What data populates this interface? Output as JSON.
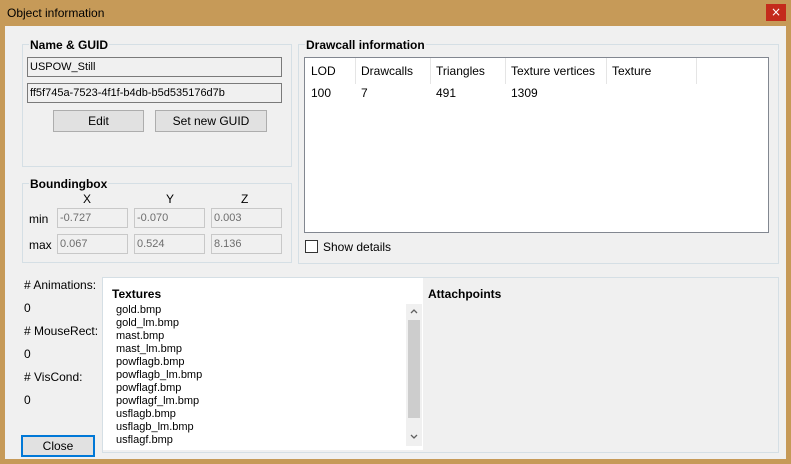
{
  "window": {
    "title": "Object information",
    "close_glyph": "×"
  },
  "name_guid": {
    "title": "Name & GUID",
    "name_value": "USPOW_Still",
    "guid_value": "ff5f745a-7523-4f1f-b4db-b5d535176d7b",
    "edit_label": "Edit",
    "set_guid_label": "Set new GUID"
  },
  "boundingbox": {
    "title": "Boundingbox",
    "col_x": "X",
    "col_y": "Y",
    "col_z": "Z",
    "min_label": "min",
    "max_label": "max",
    "min": [
      "-0.727",
      "-0.070",
      "0.003"
    ],
    "max": [
      "0.067",
      "0.524",
      "8.136"
    ]
  },
  "drawcall": {
    "title": "Drawcall information",
    "columns": [
      "LOD",
      "Drawcalls",
      "Triangles",
      "Texture vertices",
      "Texture"
    ],
    "rows": [
      [
        "100",
        "7",
        "491",
        "1309",
        ""
      ]
    ],
    "show_details_label": "Show details",
    "show_details_checked": false
  },
  "stats": {
    "animations_label": "# Animations:",
    "animations_value": "0",
    "mouserect_label": "# MouseRect:",
    "mouserect_value": "0",
    "viscond_label": "# VisCond:",
    "viscond_value": "0"
  },
  "textures": {
    "title": "Textures",
    "items": [
      "gold.bmp",
      "gold_lm.bmp",
      "mast.bmp",
      "mast_lm.bmp",
      "powflagb.bmp",
      "powflagb_lm.bmp",
      "powflagf.bmp",
      "powflagf_lm.bmp",
      "usflagb.bmp",
      "usflagb_lm.bmp",
      "usflagf.bmp"
    ]
  },
  "attachpoints": {
    "title": "Attachpoints"
  },
  "close_label": "Close",
  "colors": {
    "titlebar": "#c69a58",
    "close_red": "#c42b1c",
    "dialog_bg": "#f0f0f0"
  },
  "icons": [
    "close-icon",
    "scroll-up-icon",
    "scroll-down-icon",
    "checkbox-icon"
  ]
}
